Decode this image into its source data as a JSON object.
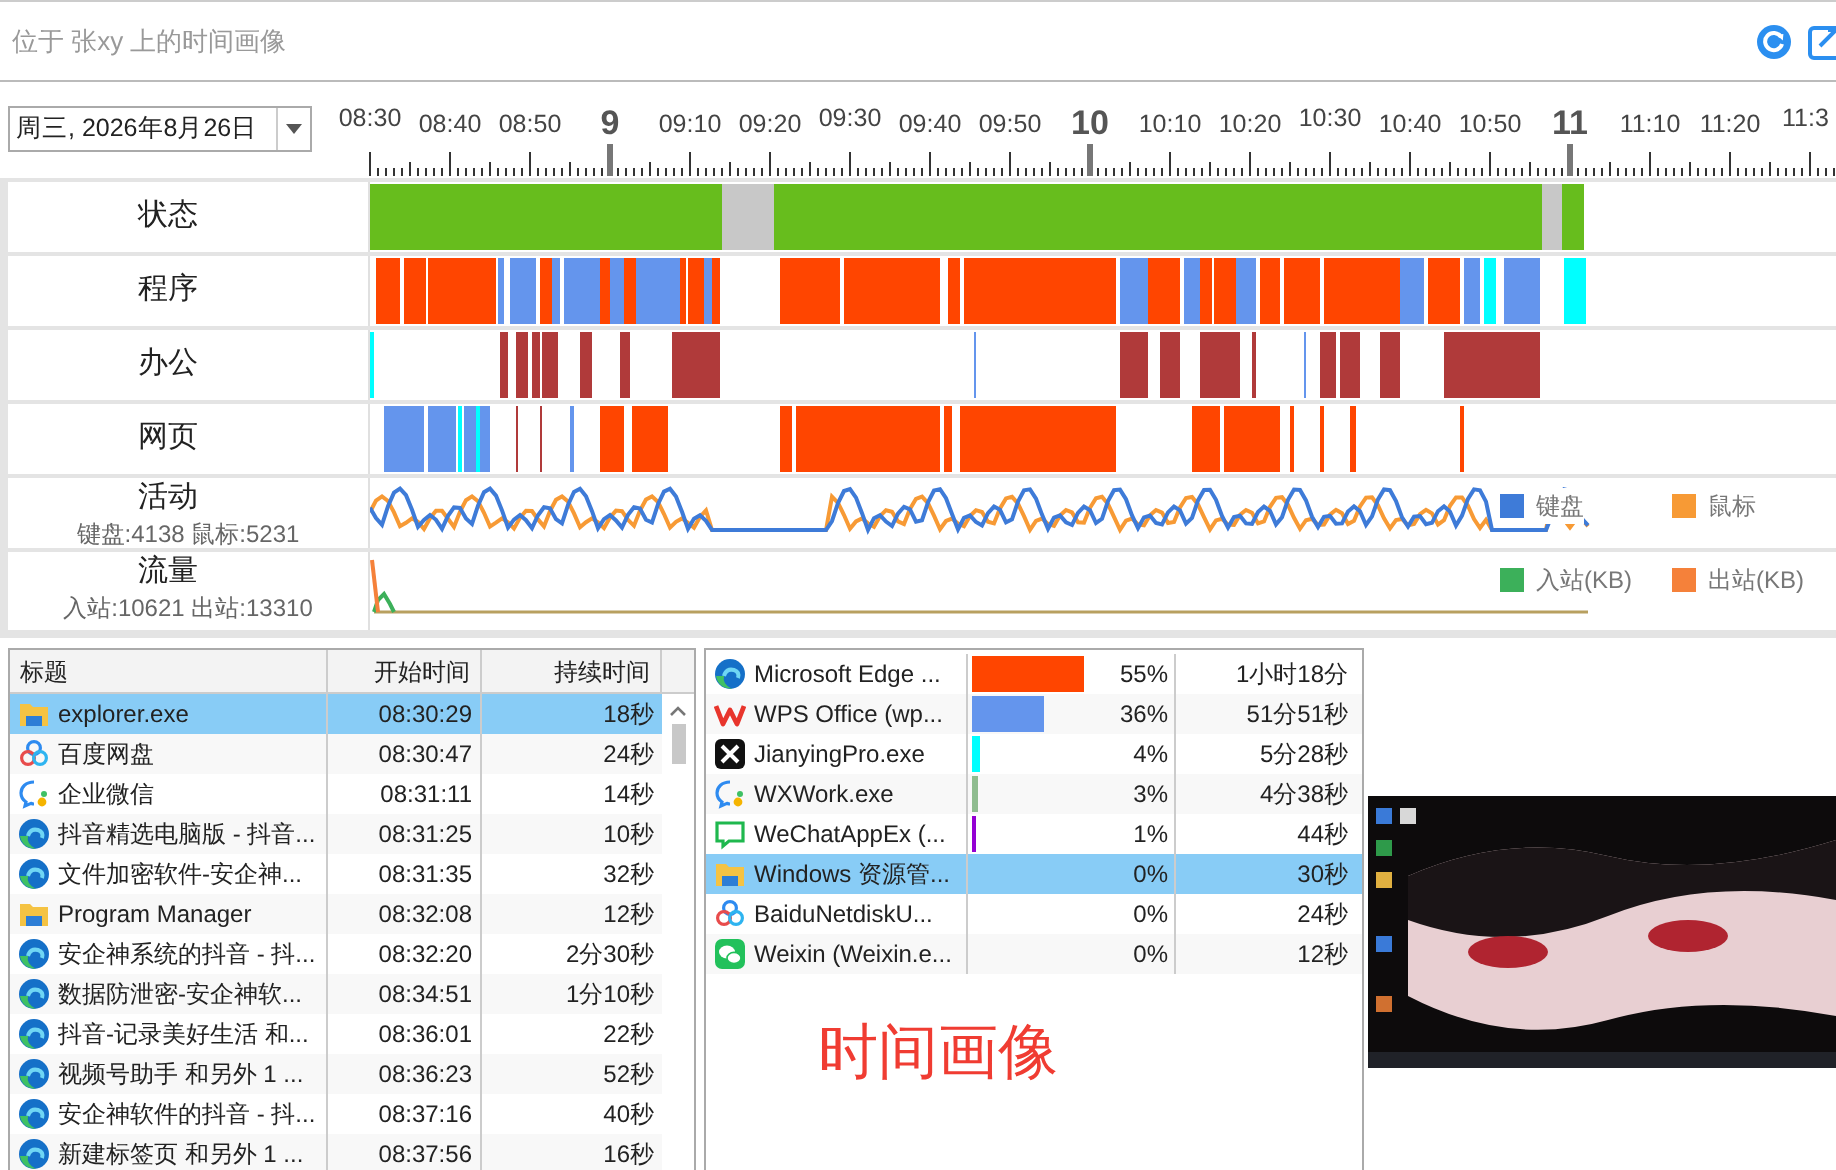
{
  "header": {
    "title": "位于 张xy 上的时间画像"
  },
  "date_picker": {
    "value": "周三, 2026年8月26日"
  },
  "time_axis": {
    "labels": [
      {
        "text": "08:30",
        "major": false
      },
      {
        "text": "08:40",
        "major": false
      },
      {
        "text": "08:50",
        "major": false
      },
      {
        "text": "9",
        "major": true
      },
      {
        "text": "09:10",
        "major": false
      },
      {
        "text": "09:20",
        "major": false
      },
      {
        "text": "09:30",
        "major": false
      },
      {
        "text": "09:40",
        "major": false
      },
      {
        "text": "09:50",
        "major": false
      },
      {
        "text": "10",
        "major": true
      },
      {
        "text": "10:10",
        "major": false
      },
      {
        "text": "10:20",
        "major": false
      },
      {
        "text": "10:30",
        "major": false
      },
      {
        "text": "10:40",
        "major": false
      },
      {
        "text": "10:50",
        "major": false
      },
      {
        "text": "11",
        "major": true
      },
      {
        "text": "11:10",
        "major": false
      },
      {
        "text": "11:20",
        "major": false
      },
      {
        "text": "11:3",
        "major": false
      }
    ]
  },
  "bands": [
    {
      "kind": "state",
      "label": "状态"
    },
    {
      "kind": "program",
      "label": "程序"
    },
    {
      "kind": "office",
      "label": "办公"
    },
    {
      "kind": "web",
      "label": "网页"
    },
    {
      "kind": "activity",
      "label": "活动",
      "summary": "键盘:4138 鼠标:5231",
      "legend": [
        {
          "text": "键盘",
          "color": "#3e7bd8"
        },
        {
          "text": "鼠标",
          "color": "#f79a35"
        }
      ]
    },
    {
      "kind": "traffic",
      "label": "流量",
      "summary": "入站:10621 出站:13310",
      "legend": [
        {
          "text": "入站(KB)",
          "color": "#3cb05a"
        },
        {
          "text": "出站(KB)",
          "color": "#f5813a"
        }
      ]
    }
  ],
  "window_list": {
    "columns": [
      "标题",
      "开始时间",
      "持续时间"
    ],
    "rows": [
      {
        "kind": "folder",
        "title": "explorer.exe",
        "start": "08:30:29",
        "duration": "18秒",
        "selected": true
      },
      {
        "kind": "baidu",
        "title": "百度网盘",
        "start": "08:30:47",
        "duration": "24秒",
        "selected": false
      },
      {
        "kind": "wxwork",
        "title": "企业微信",
        "start": "08:31:11",
        "duration": "14秒",
        "selected": false
      },
      {
        "kind": "edge",
        "title": "抖音精选电脑版 - 抖音...",
        "start": "08:31:25",
        "duration": "10秒",
        "selected": false
      },
      {
        "kind": "edge",
        "title": "文件加密软件-安企神...",
        "start": "08:31:35",
        "duration": "32秒",
        "selected": false
      },
      {
        "kind": "folder",
        "title": "Program Manager",
        "start": "08:32:08",
        "duration": "12秒",
        "selected": false
      },
      {
        "kind": "edge",
        "title": "安企神系统的抖音 - 抖...",
        "start": "08:32:20",
        "duration": "2分30秒",
        "selected": false
      },
      {
        "kind": "edge",
        "title": "数据防泄密-安企神软...",
        "start": "08:34:51",
        "duration": "1分10秒",
        "selected": false
      },
      {
        "kind": "edge",
        "title": "抖音-记录美好生活 和...",
        "start": "08:36:01",
        "duration": "22秒",
        "selected": false
      },
      {
        "kind": "edge",
        "title": "视频号助手 和另外 1 ...",
        "start": "08:36:23",
        "duration": "52秒",
        "selected": false
      },
      {
        "kind": "edge",
        "title": "安企神软件的抖音 - 抖...",
        "start": "08:37:16",
        "duration": "40秒",
        "selected": false
      },
      {
        "kind": "edge",
        "title": "新建标签页 和另外 1 ...",
        "start": "08:37:56",
        "duration": "16秒",
        "selected": false
      }
    ]
  },
  "app_usage": {
    "rows": [
      {
        "kind": "edge",
        "name": "Microsoft Edge ...",
        "level": 0.55,
        "color": "#ff4500",
        "percent": "55%",
        "duration": "1小时18分",
        "selected": false
      },
      {
        "kind": "wps",
        "name": "WPS Office (wp...",
        "level": 0.36,
        "color": "#6495ed",
        "percent": "36%",
        "duration": "51分51秒",
        "selected": false
      },
      {
        "kind": "jianying",
        "name": "JianyingPro.exe",
        "level": 0.04,
        "color": "#00ffff",
        "percent": "4%",
        "duration": "5分28秒",
        "selected": false
      },
      {
        "kind": "wxwork",
        "name": "WXWork.exe",
        "level": 0.03,
        "color": "#8fbc8f",
        "percent": "3%",
        "duration": "4分38秒",
        "selected": false
      },
      {
        "kind": "wechatapp",
        "name": "WeChatAppEx (...",
        "level": 0.01,
        "color": "#9400d3",
        "percent": "1%",
        "duration": "44秒",
        "selected": false
      },
      {
        "kind": "folder",
        "name": "Windows 资源管...",
        "percent": "0%",
        "duration": "30秒",
        "selected": true
      },
      {
        "kind": "baidu",
        "name": "BaiduNetdiskU...",
        "percent": "0%",
        "duration": "24秒",
        "selected": false
      },
      {
        "kind": "weixin",
        "name": "Weixin (Weixin.e...",
        "percent": "0%",
        "duration": "12秒",
        "selected": false
      }
    ],
    "caption": "时间画像"
  }
}
